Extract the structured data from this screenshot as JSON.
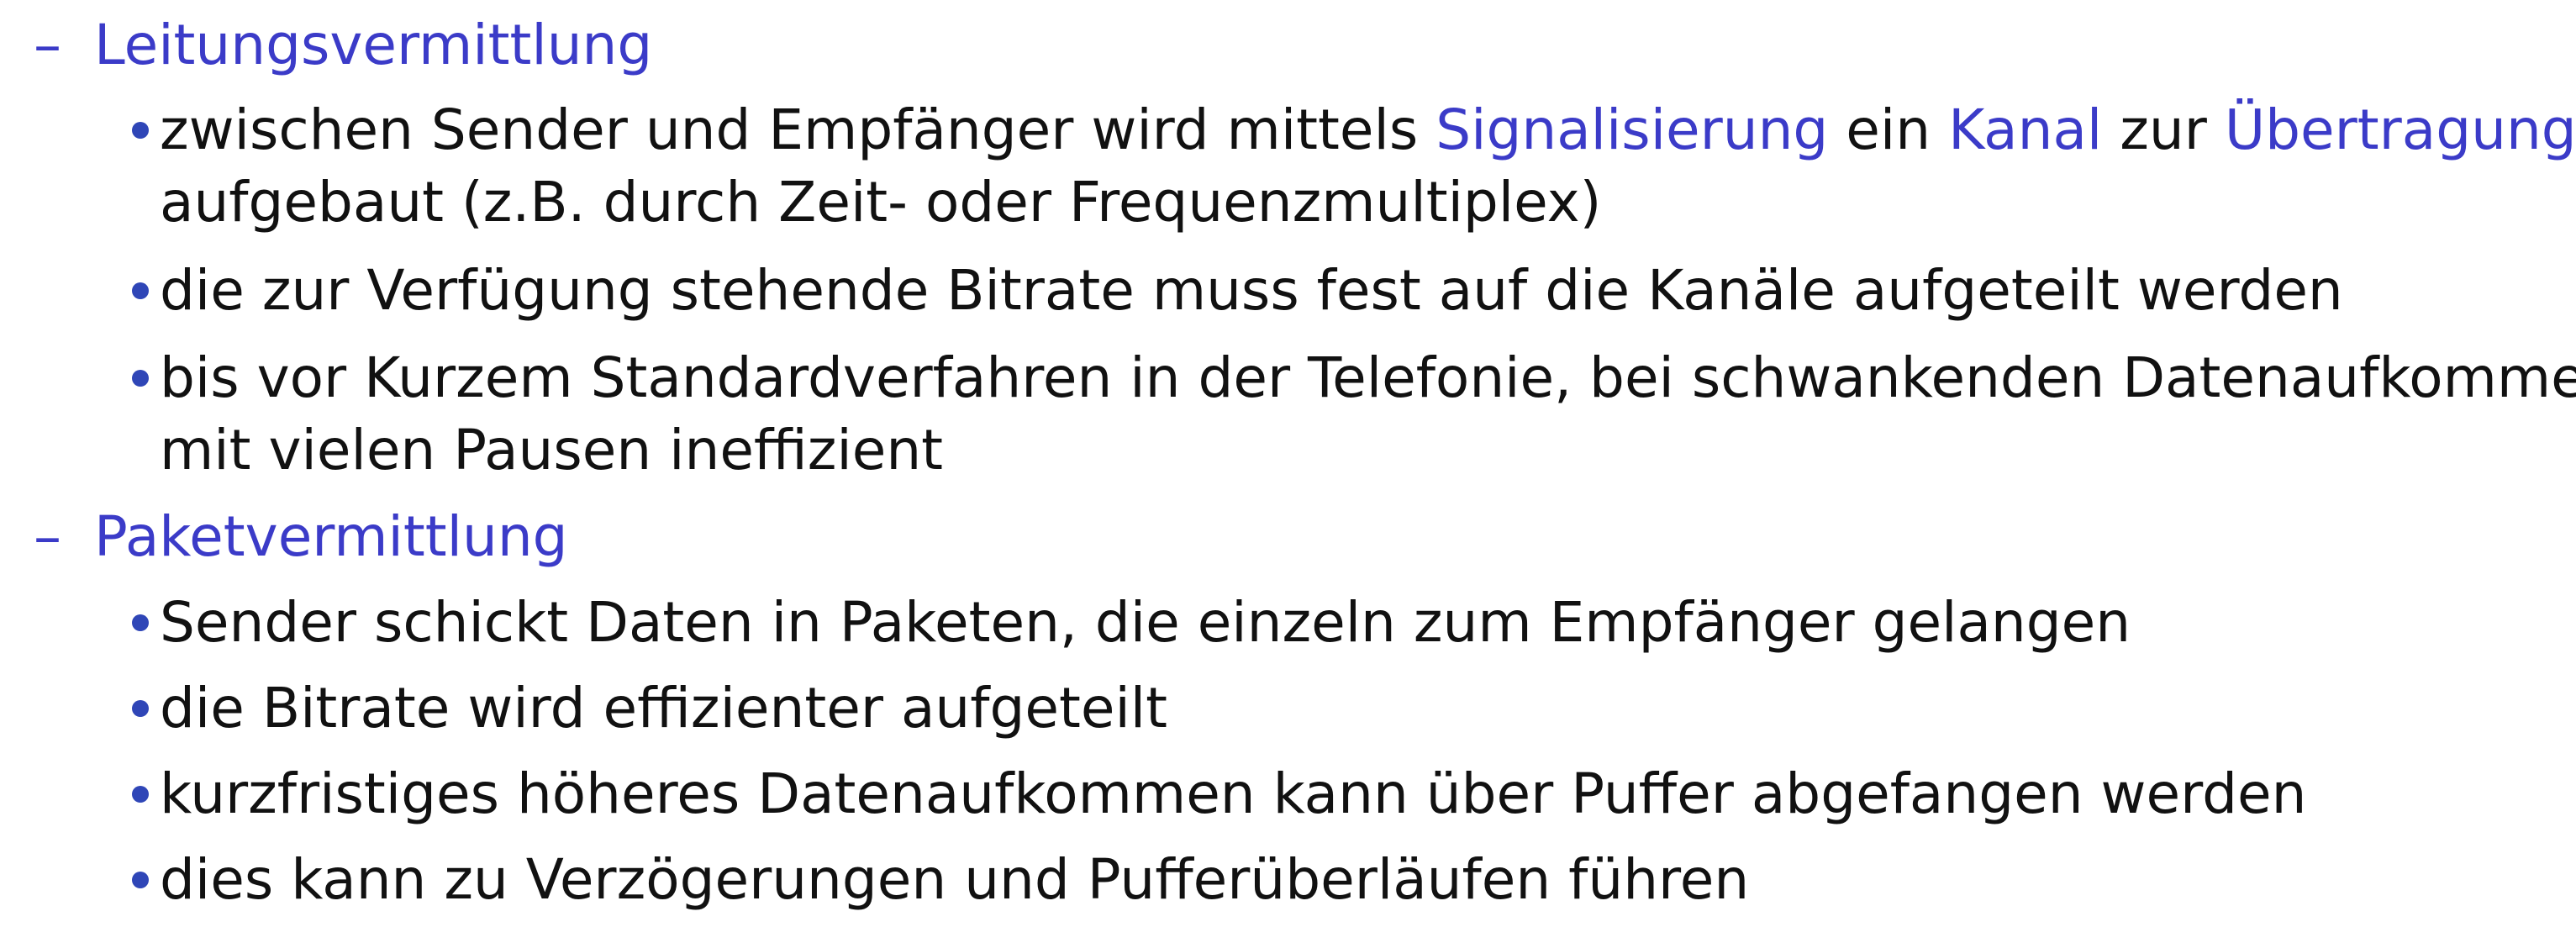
{
  "sections": [
    {
      "dash": "–",
      "heading": "Leitungsvermittlung",
      "bullets": [
        {
          "parts": [
            "zwischen Sender und Empfänger wird mittels ",
            "Signalisierung",
            " ein ",
            "Kanal",
            " zur ",
            "Übertragung"
          ],
          "line2": "aufgebaut (z.B. durch Zeit- oder Frequenzmultiplex)"
        },
        {
          "text": "die zur Verfügung stehende Bitrate muss fest auf die Kanäle aufgeteilt werden"
        },
        {
          "text": "bis vor Kurzem Standardverfahren in der Telefonie, bei schwankenden Datenaufkommen",
          "line2": "mit vielen Pausen ineffizient"
        }
      ]
    },
    {
      "dash": "–",
      "heading": "Paketvermittlung",
      "bullets": [
        {
          "text": "Sender schickt Daten in Paketen, die einzeln zum Empfänger gelangen"
        },
        {
          "text": "die Bitrate wird effizienter aufgeteilt"
        },
        {
          "text": "kurzfristiges höheres Datenaufkommen kann über Puffer abgefangen werden"
        },
        {
          "text": "dies kann zu Verzögerungen und Pufferüberläufen führen"
        }
      ]
    }
  ],
  "colors": {
    "highlight": "#3b3bc8",
    "bullet_dot": "#2f46b7",
    "body_text": "#111111"
  }
}
